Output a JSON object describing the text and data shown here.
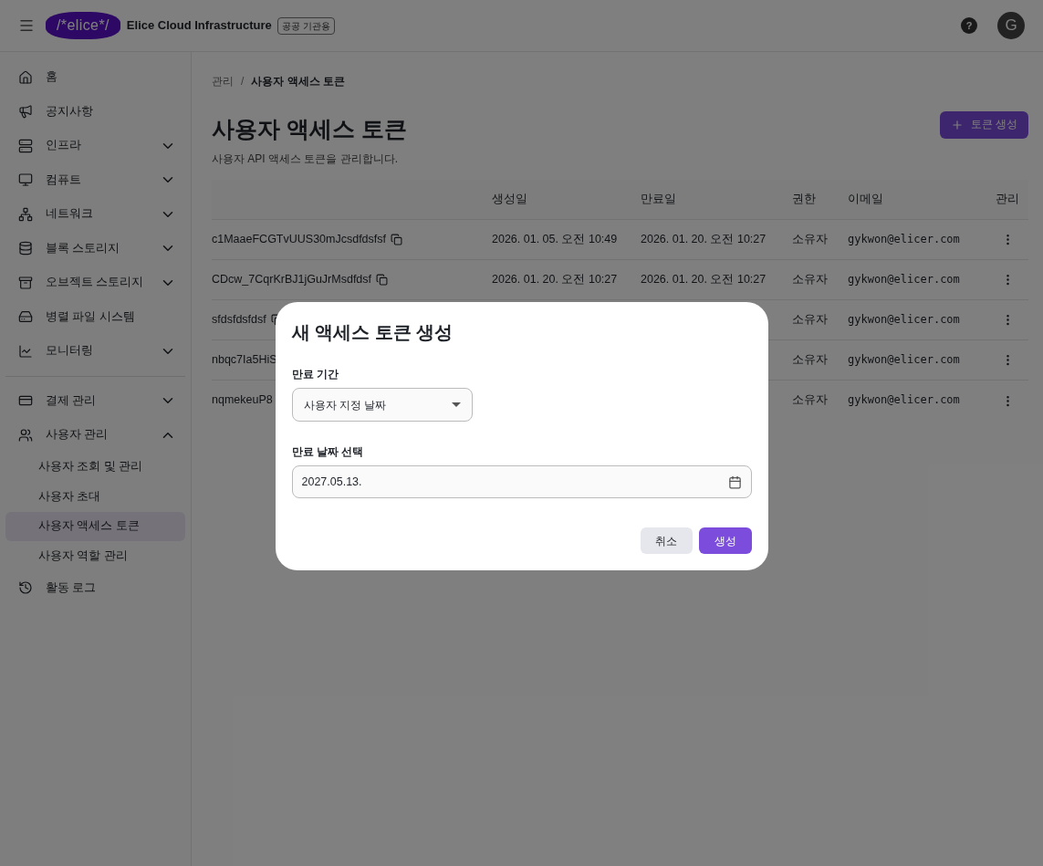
{
  "header": {
    "logo": "/*elice*/",
    "product": "Elice Cloud Infrastructure",
    "badge": "공공 기관용",
    "help": "?",
    "avatar": "G"
  },
  "sidebar": {
    "sections": [
      {
        "items": [
          {
            "label": "홈"
          },
          {
            "label": "공지사항"
          },
          {
            "label": "인프라",
            "expanded": false
          },
          {
            "label": "컴퓨트",
            "expanded": false
          },
          {
            "label": "네트워크",
            "expanded": false
          },
          {
            "label": "블록 스토리지",
            "expanded": false
          },
          {
            "label": "오브젝트 스토리지",
            "expanded": false
          },
          {
            "label": "병렬 파일 시스템"
          },
          {
            "label": "모니터링",
            "expanded": false
          }
        ]
      },
      {
        "items": [
          {
            "label": "결제 관리",
            "expanded": false
          },
          {
            "label": "사용자 관리",
            "expanded": true,
            "children": [
              {
                "label": "사용자 조회 및 관리",
                "selected": false
              },
              {
                "label": "사용자 초대",
                "selected": false
              },
              {
                "label": "사용자 액세스 토큰",
                "selected": true
              },
              {
                "label": "사용자 역할 관리",
                "selected": false
              }
            ]
          },
          {
            "label": "활동 로그"
          }
        ]
      }
    ]
  },
  "breadcrumb": {
    "items": [
      "관리",
      "사용자 액세스 토큰"
    ],
    "separator": "/"
  },
  "page": {
    "title": "사용자 액세스 토큰",
    "subtitle": "사용자 API 액세스 토큰을 관리합니다.",
    "create_button": "토큰 생성"
  },
  "table": {
    "columns": [
      "생성일",
      "만료일",
      "권한",
      "이메일",
      "관리"
    ],
    "rows": [
      {
        "token": "c1MaaeFCGTvUUS30mJcsdfdsfsf",
        "created": "2026. 01. 05. 오전 10:49",
        "expires": "2026. 01. 20. 오전 10:27",
        "role": "소유자",
        "email": "gykwon@elicer.com"
      },
      {
        "token": "CDcw_7CqrKrBJ1jGuJrMsdfdsf",
        "created": "2026. 01. 20. 오전 10:27",
        "expires": "2026. 01. 20. 오전 10:27",
        "role": "소유자",
        "email": "gykwon@elicer.com"
      },
      {
        "token": "sfdsfdsfdsf",
        "role": "소유자",
        "email": "gykwon@elicer.com"
      },
      {
        "token": "nbqc7Ia5HiS",
        "role": "소유자",
        "email": "gykwon@elicer.com"
      },
      {
        "token": "nqmekeuP8",
        "role": "소유자",
        "email": "gykwon@elicer.com"
      }
    ]
  },
  "dialog": {
    "title": "새 액세스 토큰 생성",
    "period_label": "만료 기간",
    "period_value": "사용자 지정 날짜",
    "date_label": "만료 날짜 선택",
    "date_value": "2027.05.13.",
    "cancel": "취소",
    "submit": "생성"
  }
}
